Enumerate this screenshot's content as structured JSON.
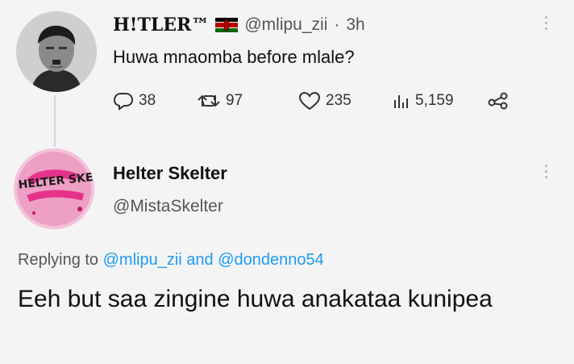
{
  "tweet": {
    "author_name": "H!TLER™",
    "author_handle": "@mlipu_zii",
    "separator": "·",
    "time": "3h",
    "text": "Huwa mnaomba before mlale?",
    "replies": "38",
    "retweets": "97",
    "likes": "235",
    "views": "5,159"
  },
  "reply": {
    "author_name": "Helter Skelter",
    "author_handle": "@MistaSkelter",
    "replying_prefix": "Replying to",
    "mention_1": "@mlipu_zii",
    "conjunction": "and",
    "mention_2": "@dondenno54",
    "text": "Eeh but saa zingine huwa anakataa kunipea",
    "avatar_text": "HELTER SKELTER"
  },
  "icons": [
    "kenya-flag-icon",
    "reply-icon",
    "retweet-icon",
    "like-icon",
    "views-icon",
    "share-icon",
    "more-icon"
  ],
  "colors": {
    "mention": "#1d9bf0",
    "secondary_text": "#555555",
    "avatar_pink": "#e5338b"
  }
}
